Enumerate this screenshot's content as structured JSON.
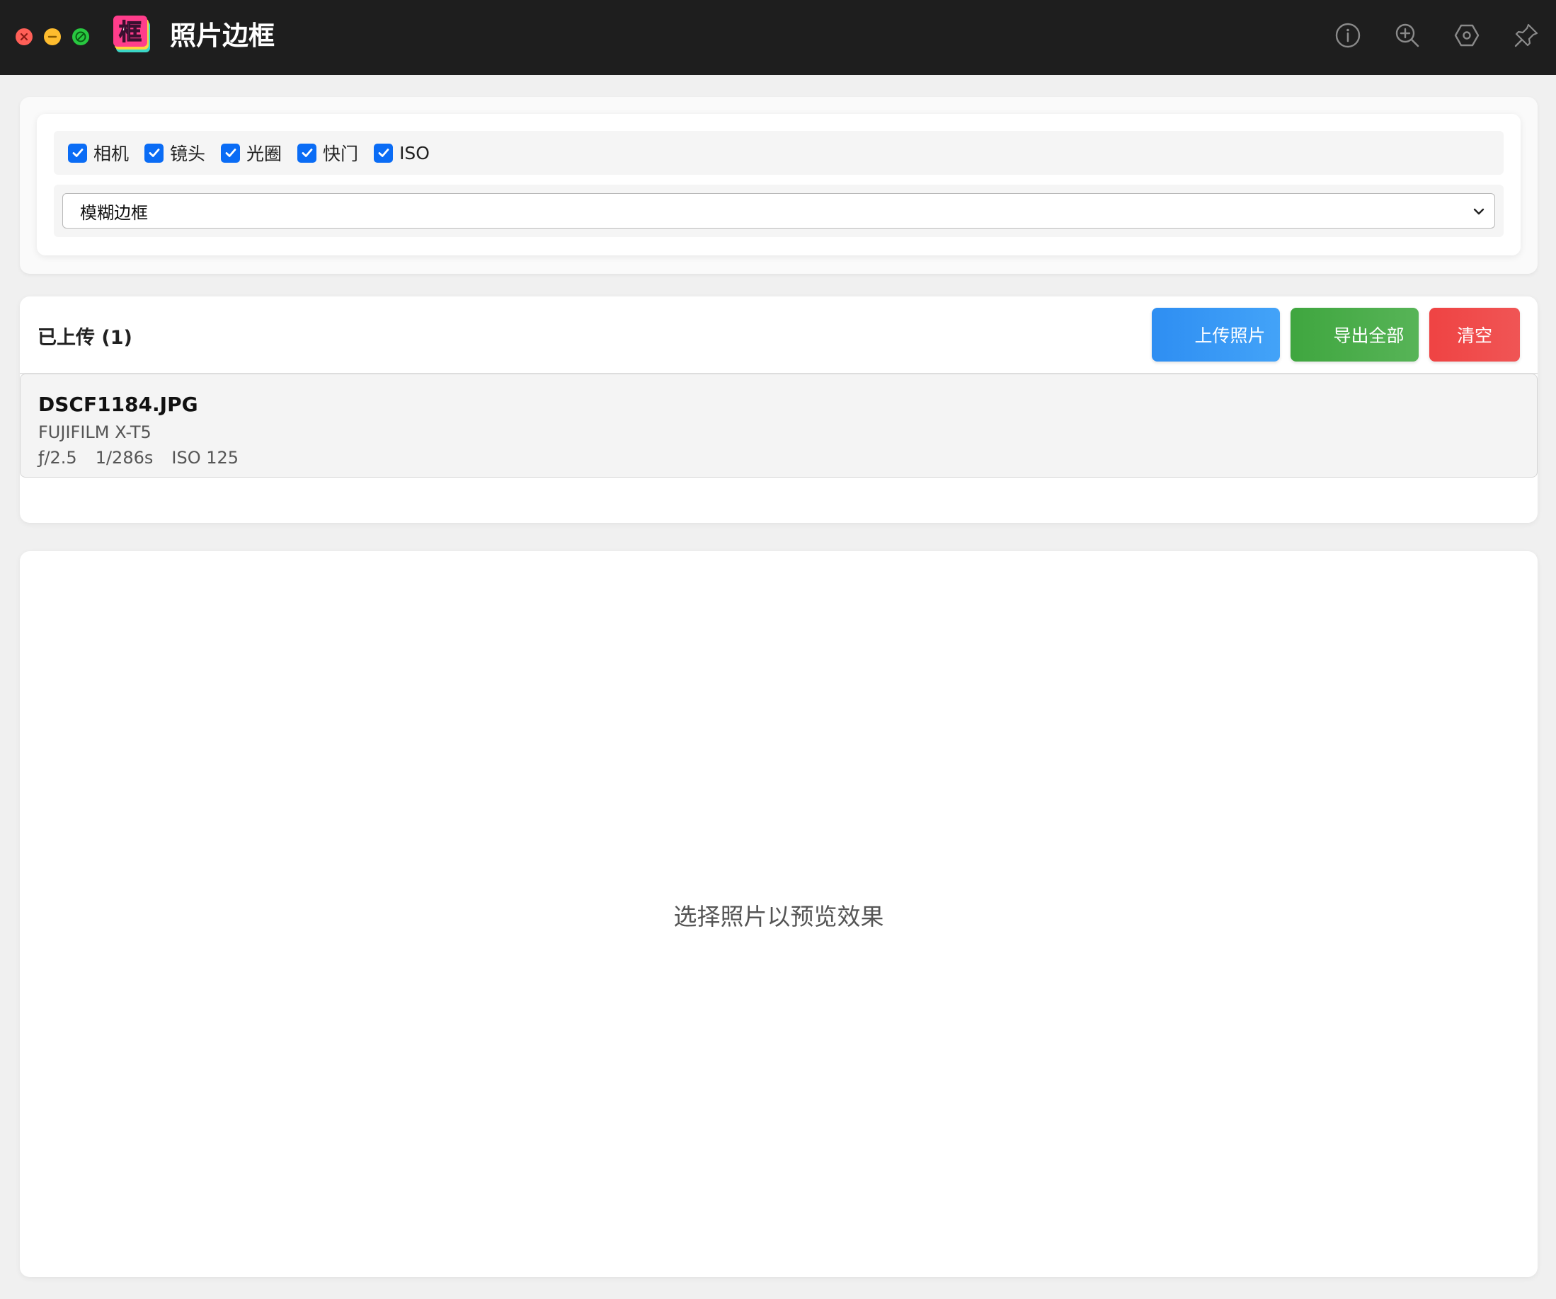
{
  "window": {
    "title": "照片边框",
    "logo_text": "框"
  },
  "toolbar": {
    "icons": [
      "info-icon",
      "zoom-in-icon",
      "settings-icon",
      "pin-icon"
    ]
  },
  "options": [
    {
      "label": "相机",
      "checked": true
    },
    {
      "label": "镜头",
      "checked": true
    },
    {
      "label": "光圈",
      "checked": true
    },
    {
      "label": "快门",
      "checked": true
    },
    {
      "label": "ISO",
      "checked": true
    }
  ],
  "frame_style": {
    "selected": "模糊边框"
  },
  "uploads": {
    "title": "已上传 (1)",
    "upload_label": "上传照片",
    "export_label": "导出全部",
    "clear_label": "清空",
    "files": [
      {
        "name": "DSCF1184.JPG",
        "camera": "FUJIFILM X-T5",
        "aperture": "ƒ/2.5",
        "shutter": "1/286s",
        "iso": "ISO 125"
      }
    ]
  },
  "preview": {
    "placeholder": "选择照片以预览效果"
  },
  "colors": {
    "upload_button": "#2e8ef2",
    "export_button": "#3fa63f",
    "clear_button": "#ef4343",
    "checkbox": "#0a6cf5",
    "titlebar": "#1e1e1e"
  }
}
